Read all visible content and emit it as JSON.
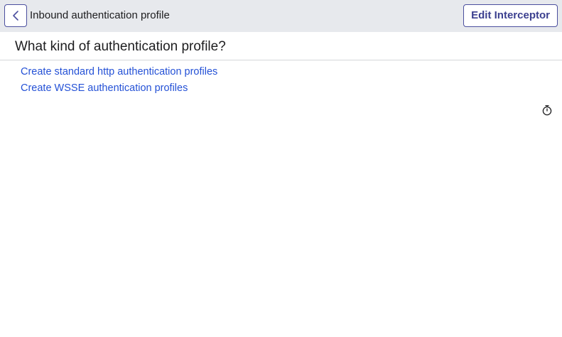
{
  "header": {
    "back_icon": "chevron-left-icon",
    "title": "Inbound authentication profile",
    "edit_label": "Edit Interceptor"
  },
  "main": {
    "question": "What kind of authentication profile?",
    "links": [
      {
        "label": "Create standard http authentication profiles"
      },
      {
        "label": "Create WSSE authentication profiles"
      }
    ],
    "timer_icon": "stopwatch-icon"
  },
  "colors": {
    "header_bg": "#e7e9ed",
    "accent": "#4b4f9e",
    "link": "#2451d6"
  }
}
